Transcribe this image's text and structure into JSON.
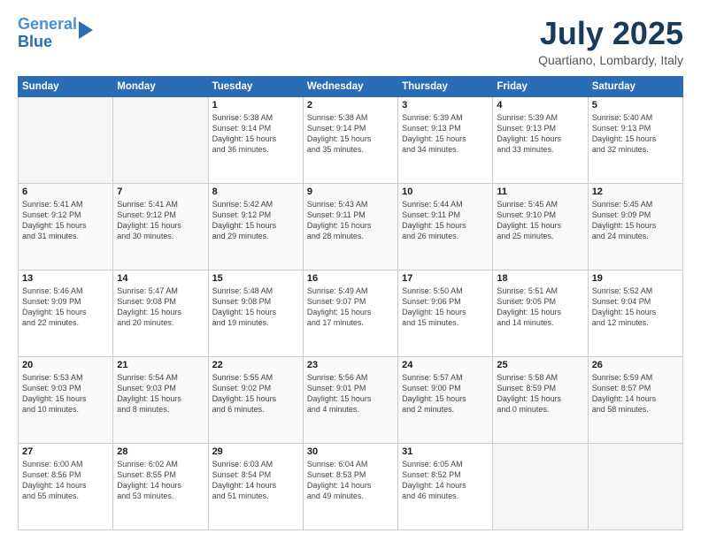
{
  "logo": {
    "line1": "General",
    "line2": "Blue"
  },
  "title": "July 2025",
  "location": "Quartiano, Lombardy, Italy",
  "weekdays": [
    "Sunday",
    "Monday",
    "Tuesday",
    "Wednesday",
    "Thursday",
    "Friday",
    "Saturday"
  ],
  "weeks": [
    [
      {
        "day": "",
        "info": ""
      },
      {
        "day": "",
        "info": ""
      },
      {
        "day": "1",
        "info": "Sunrise: 5:38 AM\nSunset: 9:14 PM\nDaylight: 15 hours\nand 36 minutes."
      },
      {
        "day": "2",
        "info": "Sunrise: 5:38 AM\nSunset: 9:14 PM\nDaylight: 15 hours\nand 35 minutes."
      },
      {
        "day": "3",
        "info": "Sunrise: 5:39 AM\nSunset: 9:13 PM\nDaylight: 15 hours\nand 34 minutes."
      },
      {
        "day": "4",
        "info": "Sunrise: 5:39 AM\nSunset: 9:13 PM\nDaylight: 15 hours\nand 33 minutes."
      },
      {
        "day": "5",
        "info": "Sunrise: 5:40 AM\nSunset: 9:13 PM\nDaylight: 15 hours\nand 32 minutes."
      }
    ],
    [
      {
        "day": "6",
        "info": "Sunrise: 5:41 AM\nSunset: 9:12 PM\nDaylight: 15 hours\nand 31 minutes."
      },
      {
        "day": "7",
        "info": "Sunrise: 5:41 AM\nSunset: 9:12 PM\nDaylight: 15 hours\nand 30 minutes."
      },
      {
        "day": "8",
        "info": "Sunrise: 5:42 AM\nSunset: 9:12 PM\nDaylight: 15 hours\nand 29 minutes."
      },
      {
        "day": "9",
        "info": "Sunrise: 5:43 AM\nSunset: 9:11 PM\nDaylight: 15 hours\nand 28 minutes."
      },
      {
        "day": "10",
        "info": "Sunrise: 5:44 AM\nSunset: 9:11 PM\nDaylight: 15 hours\nand 26 minutes."
      },
      {
        "day": "11",
        "info": "Sunrise: 5:45 AM\nSunset: 9:10 PM\nDaylight: 15 hours\nand 25 minutes."
      },
      {
        "day": "12",
        "info": "Sunrise: 5:45 AM\nSunset: 9:09 PM\nDaylight: 15 hours\nand 24 minutes."
      }
    ],
    [
      {
        "day": "13",
        "info": "Sunrise: 5:46 AM\nSunset: 9:09 PM\nDaylight: 15 hours\nand 22 minutes."
      },
      {
        "day": "14",
        "info": "Sunrise: 5:47 AM\nSunset: 9:08 PM\nDaylight: 15 hours\nand 20 minutes."
      },
      {
        "day": "15",
        "info": "Sunrise: 5:48 AM\nSunset: 9:08 PM\nDaylight: 15 hours\nand 19 minutes."
      },
      {
        "day": "16",
        "info": "Sunrise: 5:49 AM\nSunset: 9:07 PM\nDaylight: 15 hours\nand 17 minutes."
      },
      {
        "day": "17",
        "info": "Sunrise: 5:50 AM\nSunset: 9:06 PM\nDaylight: 15 hours\nand 15 minutes."
      },
      {
        "day": "18",
        "info": "Sunrise: 5:51 AM\nSunset: 9:05 PM\nDaylight: 15 hours\nand 14 minutes."
      },
      {
        "day": "19",
        "info": "Sunrise: 5:52 AM\nSunset: 9:04 PM\nDaylight: 15 hours\nand 12 minutes."
      }
    ],
    [
      {
        "day": "20",
        "info": "Sunrise: 5:53 AM\nSunset: 9:03 PM\nDaylight: 15 hours\nand 10 minutes."
      },
      {
        "day": "21",
        "info": "Sunrise: 5:54 AM\nSunset: 9:03 PM\nDaylight: 15 hours\nand 8 minutes."
      },
      {
        "day": "22",
        "info": "Sunrise: 5:55 AM\nSunset: 9:02 PM\nDaylight: 15 hours\nand 6 minutes."
      },
      {
        "day": "23",
        "info": "Sunrise: 5:56 AM\nSunset: 9:01 PM\nDaylight: 15 hours\nand 4 minutes."
      },
      {
        "day": "24",
        "info": "Sunrise: 5:57 AM\nSunset: 9:00 PM\nDaylight: 15 hours\nand 2 minutes."
      },
      {
        "day": "25",
        "info": "Sunrise: 5:58 AM\nSunset: 8:59 PM\nDaylight: 15 hours\nand 0 minutes."
      },
      {
        "day": "26",
        "info": "Sunrise: 5:59 AM\nSunset: 8:57 PM\nDaylight: 14 hours\nand 58 minutes."
      }
    ],
    [
      {
        "day": "27",
        "info": "Sunrise: 6:00 AM\nSunset: 8:56 PM\nDaylight: 14 hours\nand 55 minutes."
      },
      {
        "day": "28",
        "info": "Sunrise: 6:02 AM\nSunset: 8:55 PM\nDaylight: 14 hours\nand 53 minutes."
      },
      {
        "day": "29",
        "info": "Sunrise: 6:03 AM\nSunset: 8:54 PM\nDaylight: 14 hours\nand 51 minutes."
      },
      {
        "day": "30",
        "info": "Sunrise: 6:04 AM\nSunset: 8:53 PM\nDaylight: 14 hours\nand 49 minutes."
      },
      {
        "day": "31",
        "info": "Sunrise: 6:05 AM\nSunset: 8:52 PM\nDaylight: 14 hours\nand 46 minutes."
      },
      {
        "day": "",
        "info": ""
      },
      {
        "day": "",
        "info": ""
      }
    ]
  ]
}
